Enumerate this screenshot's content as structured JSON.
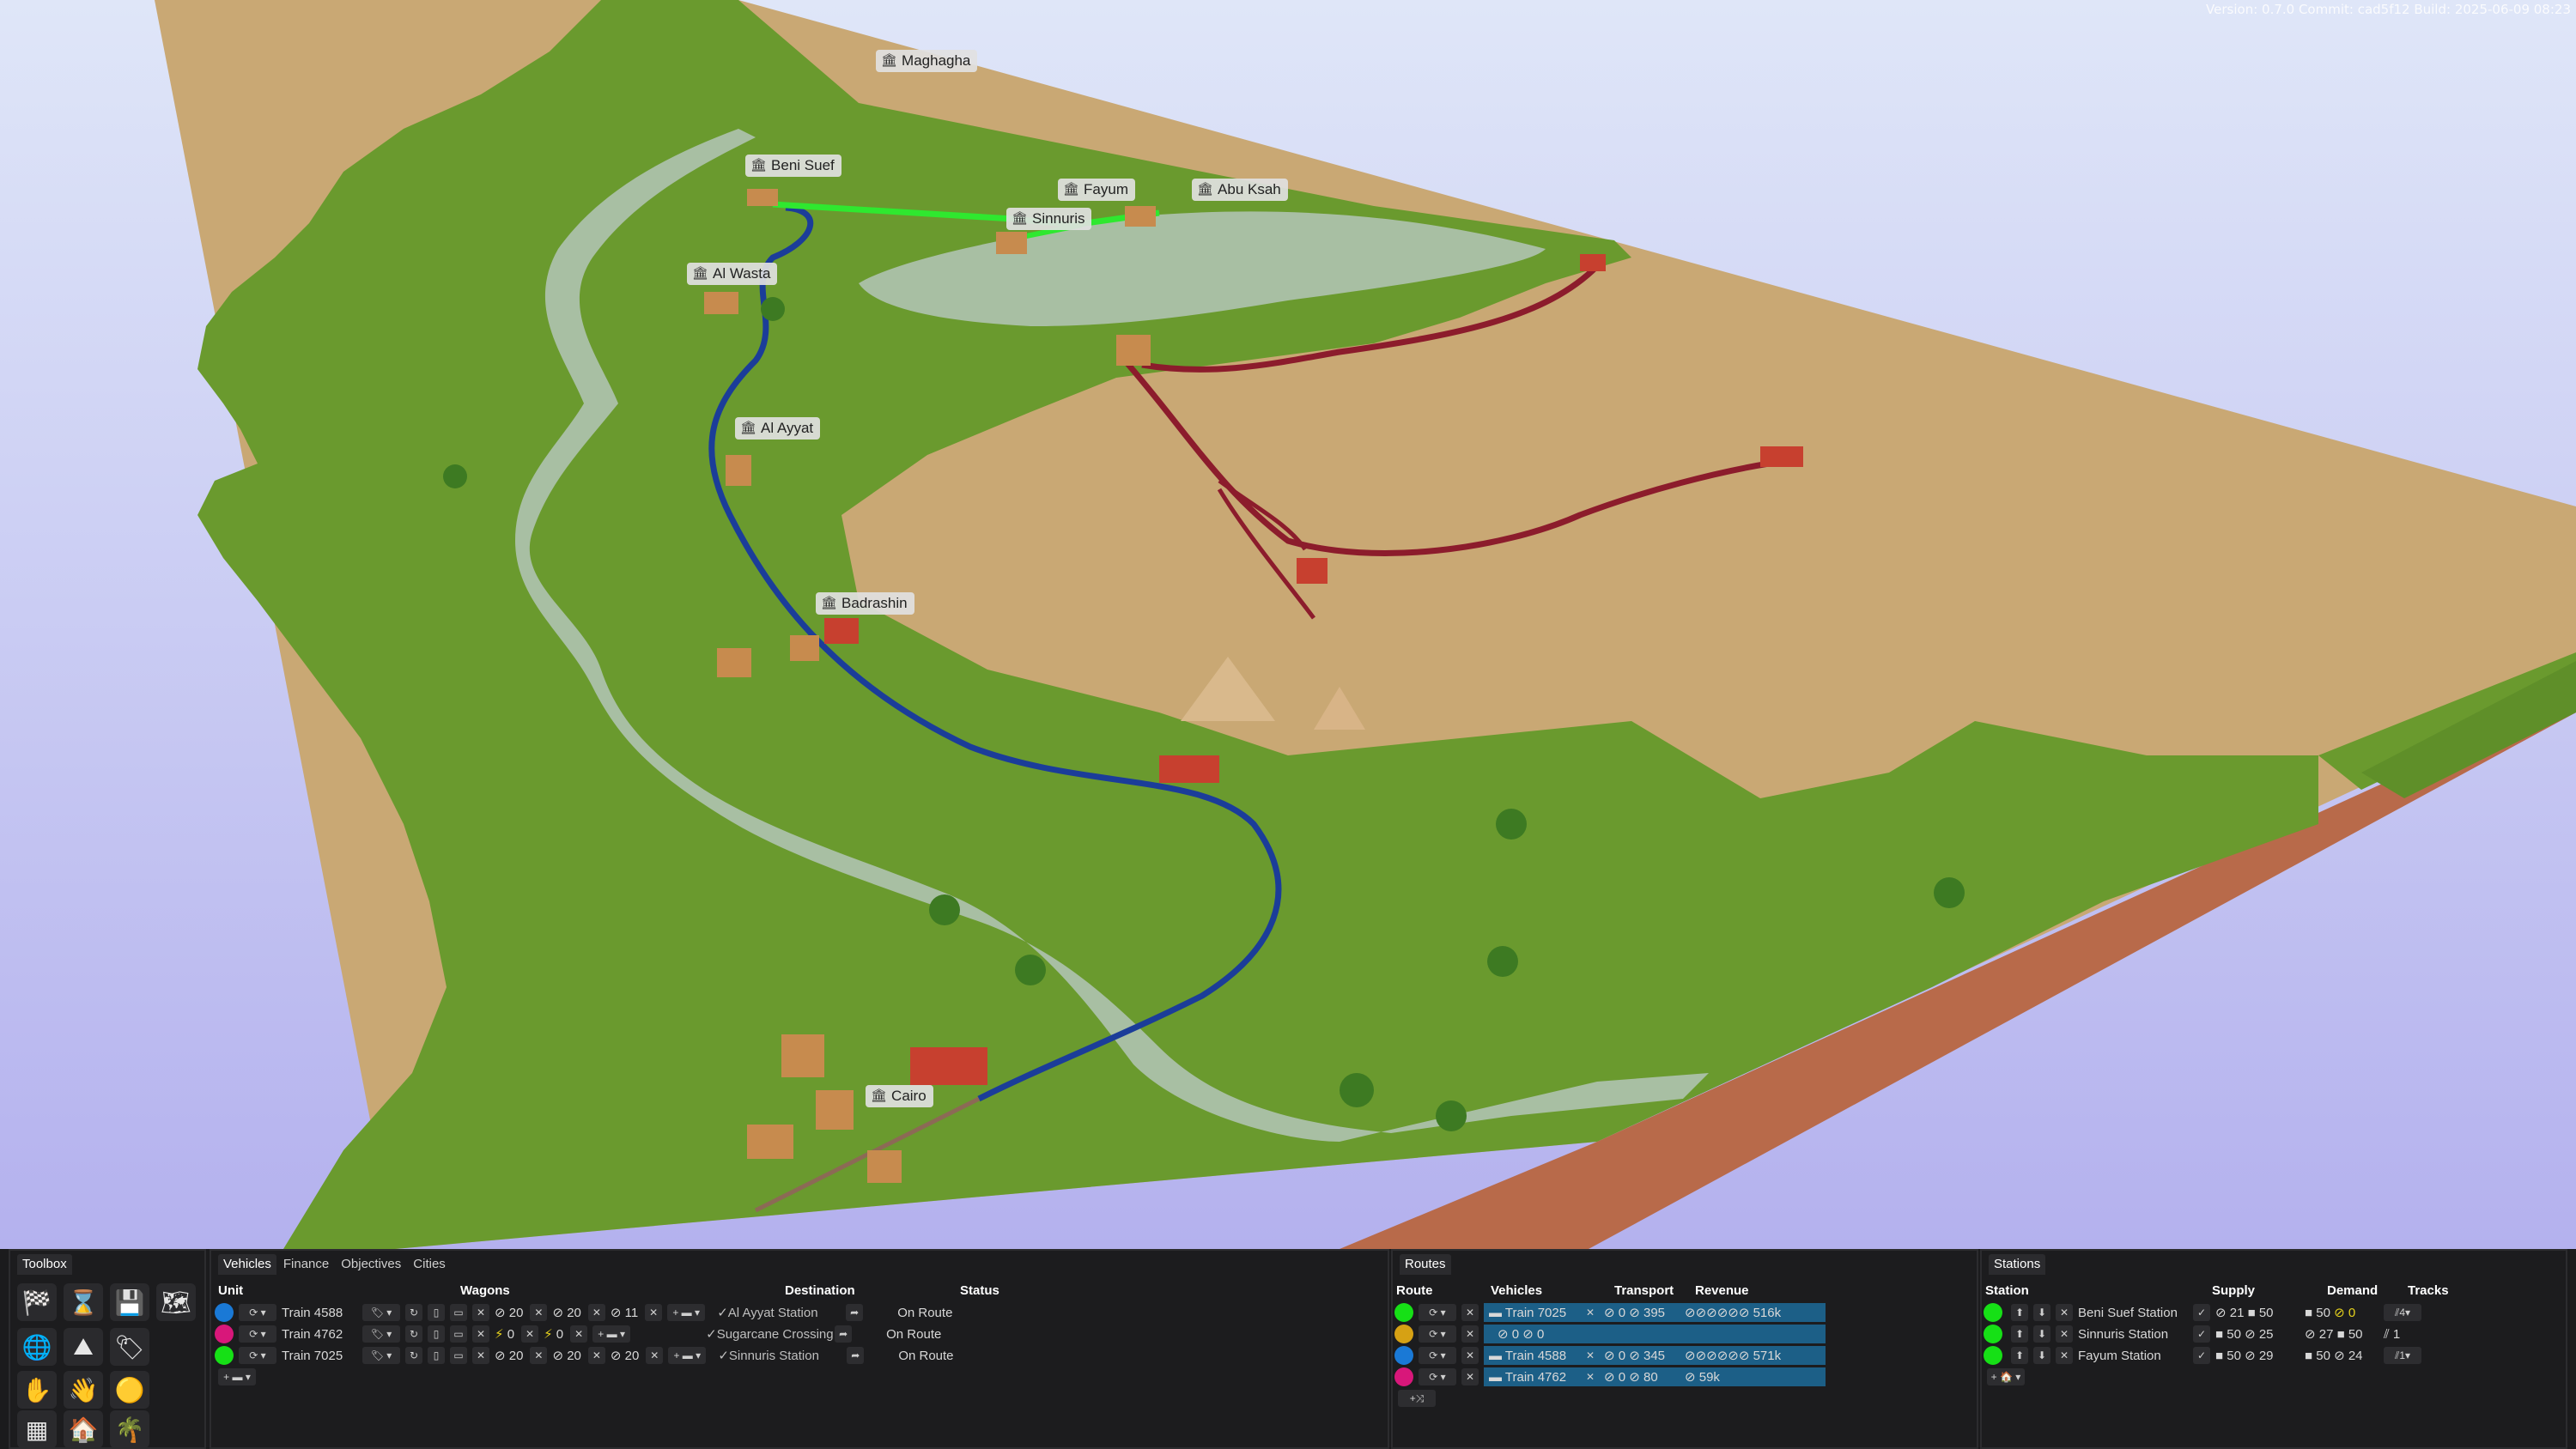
{
  "version_text": "Version: 0.7.0 Commit: cad5f12 Build: 2025-06-09 08:23",
  "map": {
    "cities": [
      {
        "name": "Maghagha"
      },
      {
        "name": "Beni Suef"
      },
      {
        "name": "Fayum"
      },
      {
        "name": "Abu Ksah"
      },
      {
        "name": "Sinnuris"
      },
      {
        "name": "Al Wasta"
      },
      {
        "name": "Al Ayyat"
      },
      {
        "name": "Badrashin"
      },
      {
        "name": "Cairo"
      }
    ],
    "route_colors": {
      "blue": "#1b3d99",
      "green": "#2fe82f",
      "red": "#8c1c2c",
      "river": "#a8bfa3"
    }
  },
  "toolbox": {
    "title": "Toolbox",
    "tools": [
      "flag-icon",
      "hourglass-icon",
      "save-icon",
      "map-icon",
      "globe-icon",
      "mountain-icon",
      "tag-icon",
      "hand-lower-icon",
      "hand-raise-icon",
      "resource-icon",
      "grid-map-icon",
      "house-icon",
      "palm-icon"
    ]
  },
  "vehicles_panel": {
    "tabs": [
      "Vehicles",
      "Finance",
      "Objectives",
      "Cities"
    ],
    "active_tab": "Vehicles",
    "headers": {
      "unit": "Unit",
      "wagons": "Wagons",
      "destination": "Destination",
      "status": "Status"
    },
    "rows": [
      {
        "color": "#1a79d6",
        "name": "Train 4588",
        "w1": "20",
        "w2": "20",
        "w3": "11",
        "destination": "Al Ayyat Station",
        "status": "On Route"
      },
      {
        "color": "#d8177a",
        "name": "Train 4762",
        "w1": "0",
        "w2": "0",
        "w3": "",
        "destination": "Sugarcane Crossing",
        "status": "On Route"
      },
      {
        "color": "#16e016",
        "name": "Train 7025",
        "w1": "20",
        "w2": "20",
        "w3": "20",
        "destination": "Sinnuris Station",
        "status": "On Route"
      }
    ]
  },
  "routes_panel": {
    "title": "Routes",
    "headers": {
      "route": "Route",
      "vehicles": "Vehicles",
      "transport": "Transport",
      "revenue": "Revenue"
    },
    "rows": [
      {
        "color": "#16e016",
        "vehicle": "Train 7025",
        "t1": "0",
        "t2": "395",
        "revenue": "516k"
      },
      {
        "color": "#d6a114",
        "vehicle": "",
        "t1": "0",
        "t2": "0",
        "revenue": ""
      },
      {
        "color": "#1a79d6",
        "vehicle": "Train 4588",
        "t1": "0",
        "t2": "345",
        "revenue": "571k"
      },
      {
        "color": "#d8177a",
        "vehicle": "Train 4762",
        "t1": "0",
        "t2": "80",
        "revenue": "59k"
      }
    ]
  },
  "stations_panel": {
    "title": "Stations",
    "headers": {
      "station": "Station",
      "supply": "Supply",
      "demand": "Demand",
      "tracks": "Tracks"
    },
    "rows": [
      {
        "name": "Beni Suef Station",
        "s1": "21",
        "s2": "50",
        "d1": "50",
        "d2": "0",
        "tracks": "4"
      },
      {
        "name": "Sinnuris Station",
        "s1": "50",
        "s2": "25",
        "d1": "27",
        "d2": "50",
        "tracks": "1"
      },
      {
        "name": "Fayum Station",
        "s1": "50",
        "s2": "29",
        "d1": "50",
        "d2": "24",
        "tracks": "1"
      }
    ]
  }
}
